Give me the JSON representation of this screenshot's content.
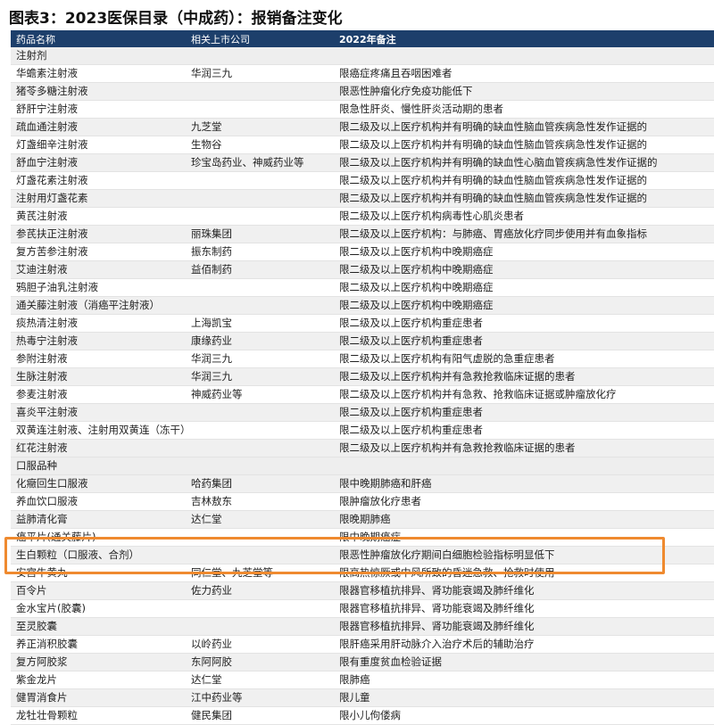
{
  "title": "图表3：2023医保目录（中成药）：报销备注变化",
  "headers": [
    "药品名称",
    "相关上市公司",
    "2022年备注"
  ],
  "rows": [
    {
      "type": "section",
      "name": "注射剂",
      "company": "",
      "note": ""
    },
    {
      "type": "row",
      "name": "华蟾素注射液",
      "company": "华润三九",
      "note": "限癌症疼痛且吞咽困难者"
    },
    {
      "type": "row",
      "name": "猪苓多糖注射液",
      "company": "",
      "note": "限恶性肿瘤化疗免疫功能低下"
    },
    {
      "type": "row",
      "name": "舒肝宁注射液",
      "company": "",
      "note": "限急性肝炎、慢性肝炎活动期的患者"
    },
    {
      "type": "row",
      "name": "疏血通注射液",
      "company": "九芝堂",
      "note": "限二级及以上医疗机构并有明确的缺血性脑血管疾病急性发作证据的"
    },
    {
      "type": "row",
      "name": "灯盏细辛注射液",
      "company": "生物谷",
      "note": "限二级及以上医疗机构并有明确的缺血性脑血管疾病急性发作证据的"
    },
    {
      "type": "row",
      "name": "舒血宁注射液",
      "company": "珍宝岛药业、神威药业等",
      "note": "限二级及以上医疗机构并有明确的缺血性心脑血管疾病急性发作证据的"
    },
    {
      "type": "row",
      "name": "灯盏花素注射液",
      "company": "",
      "note": "限二级及以上医疗机构并有明确的缺血性脑血管疾病急性发作证据的"
    },
    {
      "type": "row",
      "name": "注射用灯盏花素",
      "company": "",
      "note": "限二级及以上医疗机构并有明确的缺血性脑血管疾病急性发作证据的"
    },
    {
      "type": "row",
      "name": "黄芪注射液",
      "company": "",
      "note": "限二级及以上医疗机构病毒性心肌炎患者"
    },
    {
      "type": "row",
      "name": "参芪扶正注射液",
      "company": "丽珠集团",
      "note": "限二级及以上医疗机构：与肺癌、胃癌放化疗同步使用并有血象指标"
    },
    {
      "type": "row",
      "name": "复方苦参注射液",
      "company": "振东制药",
      "note": "限二级及以上医疗机构中晚期癌症"
    },
    {
      "type": "row",
      "name": "艾迪注射液",
      "company": "益佰制药",
      "note": "限二级及以上医疗机构中晚期癌症"
    },
    {
      "type": "row",
      "name": "鸦胆子油乳注射液",
      "company": "",
      "note": "限二级及以上医疗机构中晚期癌症"
    },
    {
      "type": "row",
      "name": "通关藤注射液（消癌平注射液）",
      "company": "",
      "note": "限二级及以上医疗机构中晚期癌症"
    },
    {
      "type": "row",
      "name": "痰热清注射液",
      "company": "上海凯宝",
      "note": "限二级及以上医疗机构重症患者"
    },
    {
      "type": "row",
      "name": "热毒宁注射液",
      "company": "康缘药业",
      "note": "限二级及以上医疗机构重症患者"
    },
    {
      "type": "row",
      "name": "参附注射液",
      "company": "华润三九",
      "note": "限二级及以上医疗机构有阳气虚脱的急重症患者"
    },
    {
      "type": "row",
      "name": "生脉注射液",
      "company": "华润三九",
      "note": "限二级及以上医疗机构并有急救抢救临床证据的患者"
    },
    {
      "type": "row",
      "name": "参麦注射液",
      "company": "神威药业等",
      "note": "限二级及以上医疗机构并有急救、抢救临床证据或肿瘤放化疗"
    },
    {
      "type": "row",
      "name": "喜炎平注射液",
      "company": "",
      "note": "限二级及以上医疗机构重症患者"
    },
    {
      "type": "row",
      "name": "双黄连注射液、注射用双黄连（冻干）",
      "company": "",
      "note": "限二级及以上医疗机构重症患者"
    },
    {
      "type": "row",
      "name": "红花注射液",
      "company": "",
      "note": "限二级及以上医疗机构并有急救抢救临床证据的患者"
    },
    {
      "type": "section",
      "name": "口服品种",
      "company": "",
      "note": ""
    },
    {
      "type": "row",
      "name": "化癥回生口服液",
      "company": "哈药集团",
      "note": "限中晚期肺癌和肝癌"
    },
    {
      "type": "row",
      "name": "养血饮口服液",
      "company": "吉林敖东",
      "note": "限肿瘤放化疗患者"
    },
    {
      "type": "row",
      "name": "益肺清化膏",
      "company": "达仁堂",
      "note": "限晚期肺癌"
    },
    {
      "type": "row",
      "name": "癌平片(通关藤片)",
      "company": "",
      "note": "限中晚期癌症"
    },
    {
      "type": "row",
      "name": "生白颗粒（口服液、合剂）",
      "company": "",
      "note": "限恶性肿瘤放化疗期间白细胞检验指标明显低下"
    },
    {
      "type": "row",
      "name": "安宫牛黄丸",
      "company": "同仁堂、九芝堂等",
      "note": "限高热惊厥或中风所致的昏迷急救、抢救时使用"
    },
    {
      "type": "row",
      "name": "百令片",
      "company": "佐力药业",
      "note": "限器官移植抗排异、肾功能衰竭及肺纤维化"
    },
    {
      "type": "row",
      "name": "金水宝片(胶囊)",
      "company": "",
      "note": "限器官移植抗排异、肾功能衰竭及肺纤维化"
    },
    {
      "type": "row",
      "name": "至灵胶囊",
      "company": "",
      "note": "限器官移植抗排异、肾功能衰竭及肺纤维化"
    },
    {
      "type": "row",
      "name": "养正消积胶囊",
      "company": "以岭药业",
      "note": "限肝癌采用肝动脉介入治疗术后的辅助治疗"
    },
    {
      "type": "row",
      "name": "复方阿胶浆",
      "company": "东阿阿胶",
      "note": "限有重度贫血检验证据"
    },
    {
      "type": "row",
      "name": "紫金龙片",
      "company": "达仁堂",
      "note": "限肺癌"
    },
    {
      "type": "row",
      "name": "健胃消食片",
      "company": "江中药业等",
      "note": "限儿童"
    },
    {
      "type": "row",
      "name": "龙牡壮骨颗粒",
      "company": "健民集团",
      "note": "限小儿佝偻病"
    }
  ]
}
